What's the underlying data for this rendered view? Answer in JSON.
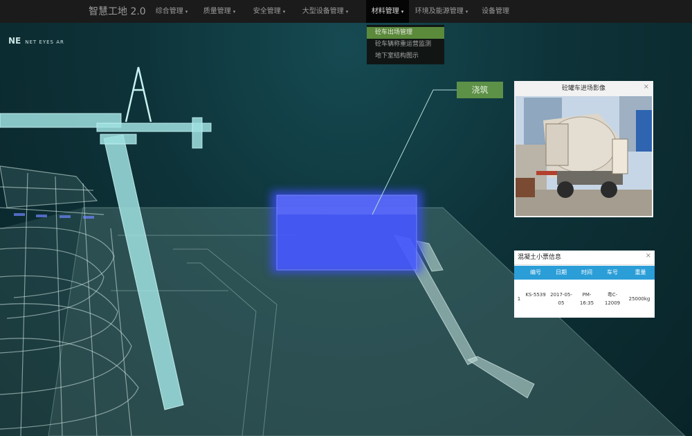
{
  "app": {
    "title": "智慧工地 2.0",
    "logo_mark": "NE",
    "logo_text": "NET EYES AR"
  },
  "nav": {
    "items": [
      {
        "label": "综合管理",
        "caret": "▾"
      },
      {
        "label": "质量管理",
        "caret": "▾"
      },
      {
        "label": "安全管理",
        "caret": "▾"
      },
      {
        "label": "大型设备管理",
        "caret": "▾"
      },
      {
        "label": "材料管理",
        "caret": "▾"
      },
      {
        "label": "环境及能源管理",
        "caret": "▾"
      },
      {
        "label": "设备管理",
        "caret": ""
      }
    ],
    "active_index": 4
  },
  "dropdown": {
    "items": [
      {
        "label": "砼车出场管理",
        "selected": true
      },
      {
        "label": "砼车辆称重运营监测",
        "selected": false
      },
      {
        "label": "地下室结构图示",
        "selected": false
      }
    ]
  },
  "scene": {
    "highlight_label": "浇筑"
  },
  "camera_panel": {
    "title": "砼罐车进场影像",
    "close": "×"
  },
  "ticket_panel": {
    "title": "混凝土小票信息",
    "close": "×",
    "columns": [
      "",
      "编号",
      "日期",
      "时间",
      "车号",
      "重量"
    ],
    "row": [
      "1",
      "KS-5539",
      "2017-05-05",
      "PM-16:35",
      "粤C-12009",
      "25000kg"
    ]
  },
  "colors": {
    "accent_green": "#5d9147",
    "header_blue": "#2b9ed8",
    "highlight_blue": "#3d4dff"
  }
}
